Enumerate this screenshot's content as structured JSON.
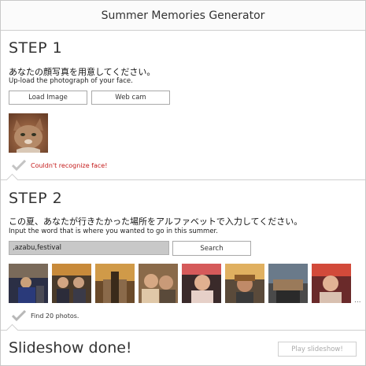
{
  "app": {
    "title": "Summer Memories Generator"
  },
  "step1": {
    "title": "STEP 1",
    "instruction_jp": "あなたの顔写真を用意してください。",
    "instruction_en": "Up-load the photograph of your face.",
    "load_button": "Load Image",
    "webcam_button": "Web cam",
    "status": "Couldn't recognize face!",
    "status_color": "#c41a1a"
  },
  "step2": {
    "title": "STEP 2",
    "instruction_jp": "この夏、あなたが行きたかった場所をアルファベットで入力してください。",
    "instruction_en": "Input the word that is where you wanted to go in this summer.",
    "search_value": ",azabu,festival",
    "search_button": "Search",
    "status": "Find 20 photos.",
    "more_indicator": "..."
  },
  "step3": {
    "title": "Slideshow done!",
    "play_button": "Play slideshow!"
  }
}
